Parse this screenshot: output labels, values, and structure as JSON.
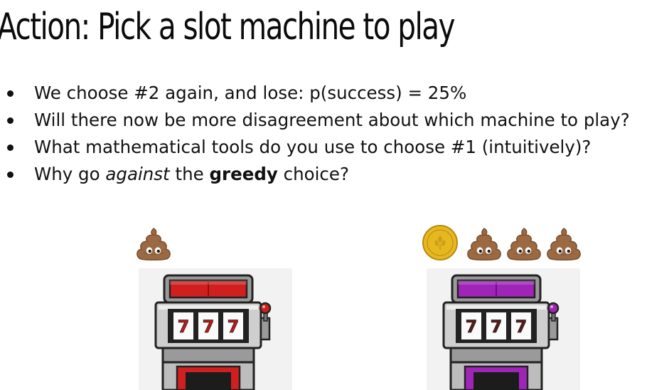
{
  "title": "Action: Pick a slot machine to play",
  "bullets": [
    {
      "parts": [
        {
          "text": "We choose #2 again, and lose: p(success) = 25%",
          "style": "normal"
        }
      ]
    },
    {
      "parts": [
        {
          "text": "Will there now be more disagreement about which machine to play?",
          "style": "normal"
        }
      ]
    },
    {
      "parts": [
        {
          "text": "What mathematical tools do you use to choose #1 (intuitively)?",
          "style": "normal"
        }
      ]
    },
    {
      "parts": [
        {
          "text": "Why go ",
          "style": "normal"
        },
        {
          "text": "against",
          "style": "italic"
        },
        {
          "text": " the ",
          "style": "normal"
        },
        {
          "text": "greedy",
          "style": "bold"
        },
        {
          "text": " choice?",
          "style": "normal"
        }
      ]
    }
  ],
  "machines": [
    {
      "id": "machine-1",
      "color": "#d11f1f",
      "dark": "#8e1010",
      "knob": "#d11f1f",
      "reel_symbol": "7",
      "reel_color": "#c01818",
      "outcomes": [
        "loss"
      ]
    },
    {
      "id": "machine-2",
      "color": "#a024b8",
      "dark": "#6a1280",
      "knob": "#a024b8",
      "reel_symbol": "7",
      "reel_color": "#5a1a1a",
      "outcomes": [
        "win",
        "loss",
        "loss",
        "loss"
      ]
    }
  ],
  "icons": {
    "win": "gold-coin-icon",
    "loss": "poop-emoji-icon"
  },
  "colors": {
    "poop": "#9b6a43",
    "poop_dark": "#7a4f2e",
    "coin": "#e6b820",
    "coin_dark": "#b8890f"
  }
}
